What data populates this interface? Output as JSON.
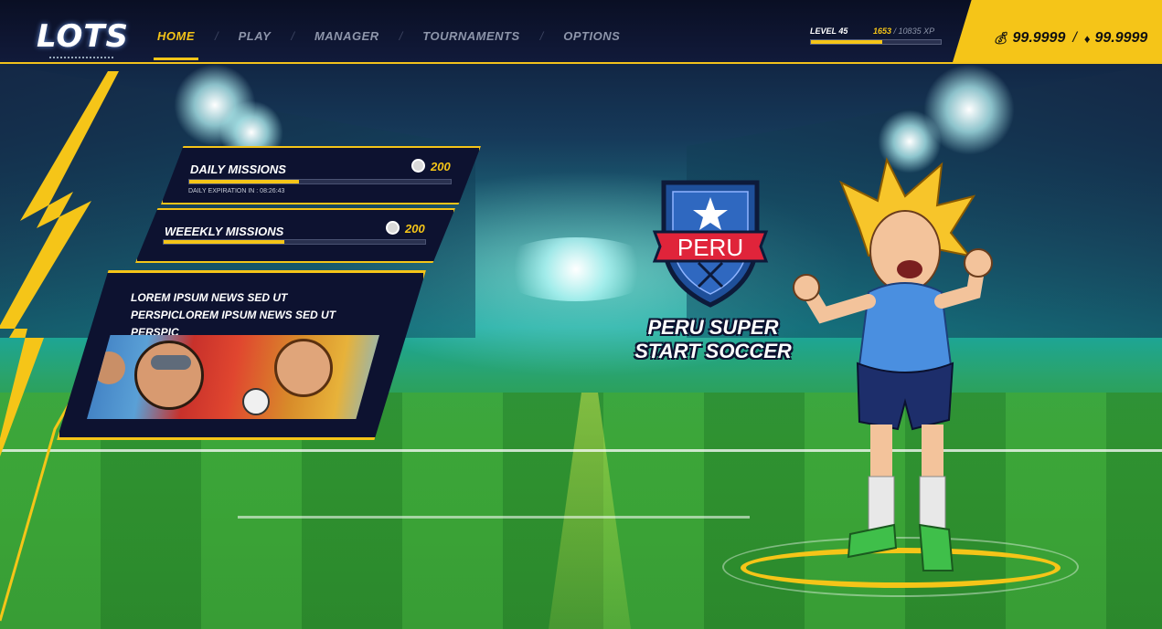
{
  "logo": {
    "text": "LOTS"
  },
  "nav": [
    {
      "label": "HOME",
      "active": true
    },
    {
      "label": "PLAY",
      "active": false
    },
    {
      "label": "MANAGER",
      "active": false
    },
    {
      "label": "TOURNAMENTS",
      "active": false
    },
    {
      "label": "OPTIONS",
      "active": false
    }
  ],
  "player_status": {
    "level_label": "LEVEL 45",
    "xp_current": "1653",
    "xp_total": "/ 10835 XP",
    "xp_progress_fraction": 0.55
  },
  "currency": {
    "coins": "99.9999",
    "separator": "/",
    "gems": "99.9999"
  },
  "missions": {
    "daily": {
      "title": "DAILY MISSIONS",
      "reward": "200",
      "expiration": "DAILY EXPIRATION IN : 08:26:43",
      "progress_fraction": 0.42
    },
    "weekly": {
      "title": "WEEEKLY MISSIONS",
      "reward": "200",
      "progress_fraction": 0.46
    }
  },
  "news": {
    "text": "LOREM IPSUM NEWS SED UT PERSPICLOREM IPSUM NEWS SED UT PERSPIC"
  },
  "team": {
    "crest_label": "PERU",
    "title_line1": "PERU SUPER",
    "title_line2": "START SOCCER"
  },
  "colors": {
    "accent": "#f5c518",
    "panel": "#0d1230",
    "crest_blue": "#1e4f9a",
    "crest_red": "#e0243a",
    "jersey": "#4a8fe0",
    "shorts": "#1d2e6b"
  },
  "icons": {
    "coin": "coin-stack-icon",
    "gem": "diamond-icon",
    "mission_reward": "coin-icon"
  }
}
